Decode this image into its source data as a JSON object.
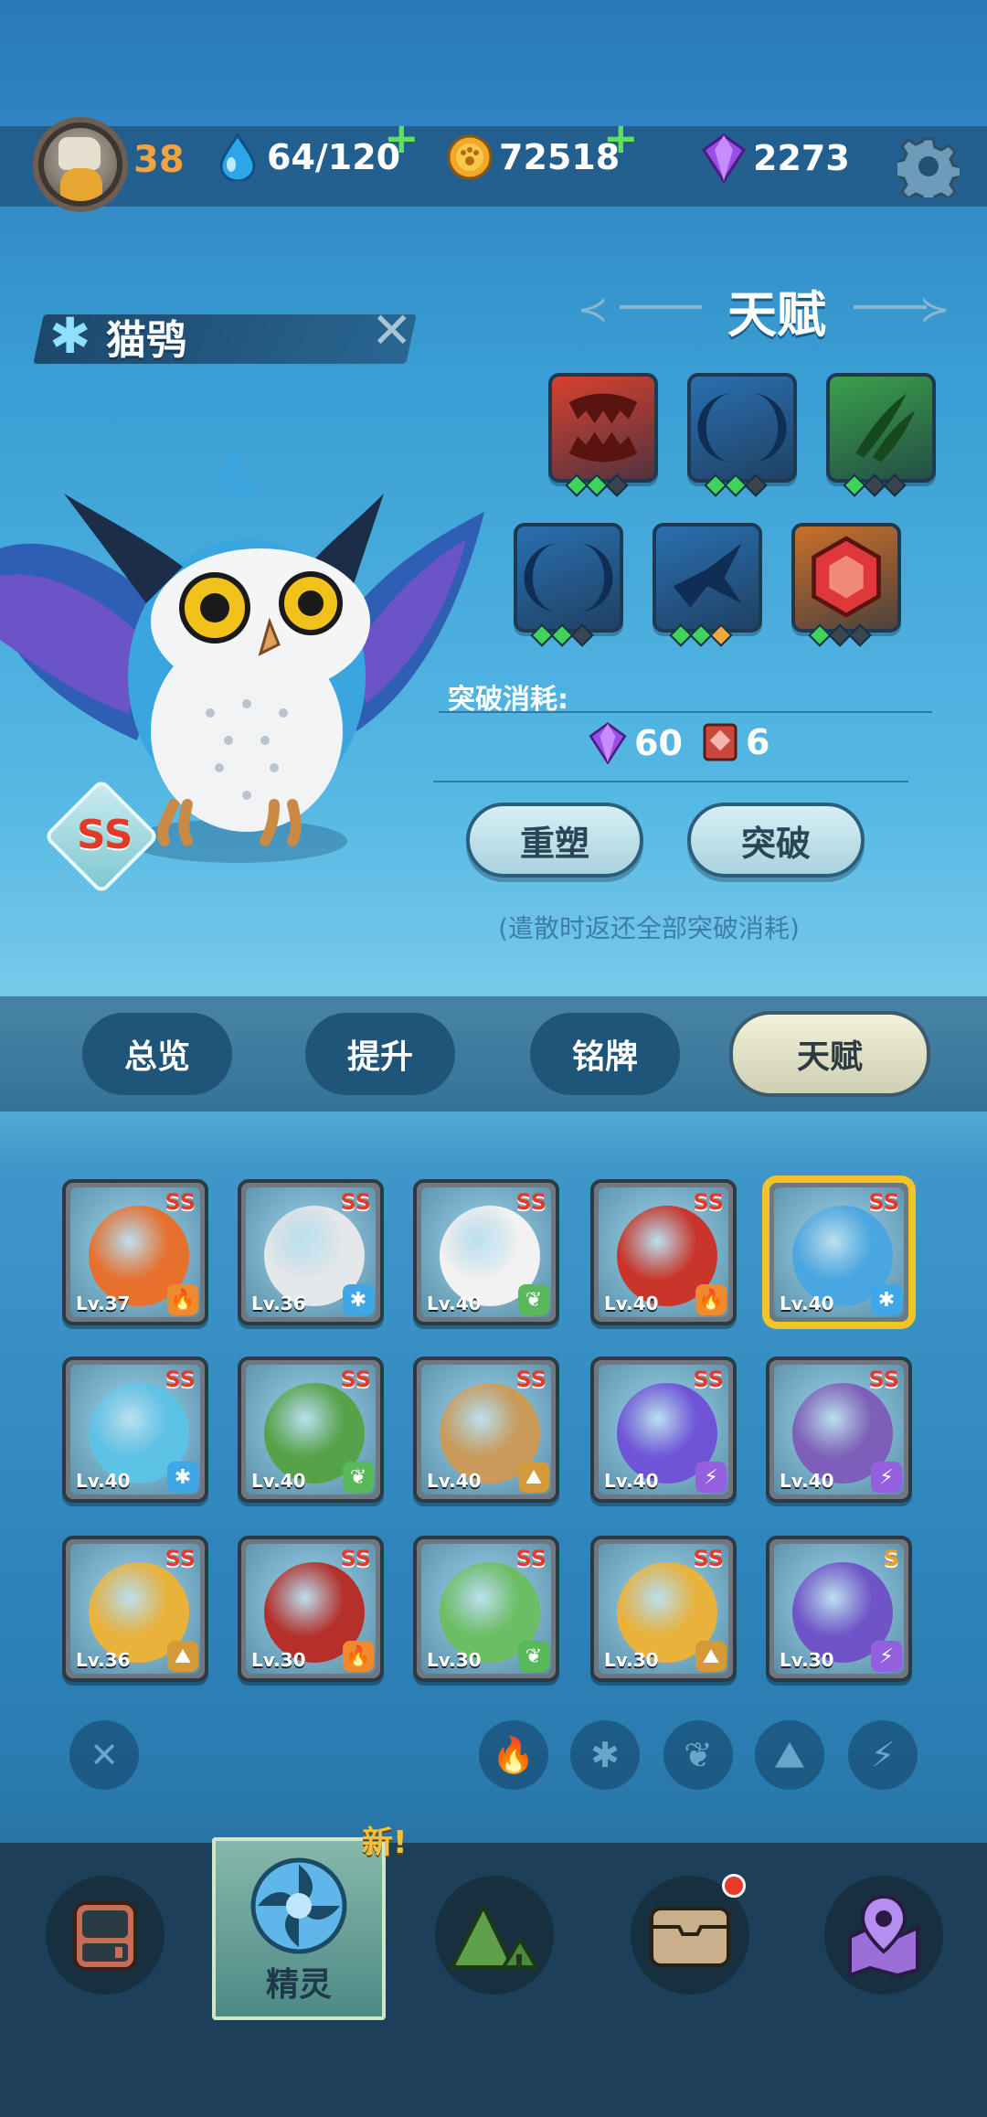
{
  "status_bar": {
    "player_level": "38",
    "stamina": "64/120",
    "coins": "72518",
    "gems": "2273",
    "plus_symbol": "+"
  },
  "creature": {
    "name": "猫鸮",
    "rank": "SS",
    "element_icon": "snowflake-icon"
  },
  "talent": {
    "title": "天赋",
    "slots": [
      {
        "icon": "fang-icon",
        "color": "#d8402f",
        "pips": [
          "g",
          "g",
          "d"
        ]
      },
      {
        "icon": "crescent-icon",
        "color": "#2a6fb0",
        "pips": [
          "g",
          "g",
          "d"
        ]
      },
      {
        "icon": "claw-icon",
        "color": "#3aa04a",
        "pips": [
          "g",
          "d",
          "d"
        ]
      },
      {
        "icon": "crescent-icon",
        "color": "#2a6fb0",
        "pips": [
          "g",
          "g",
          "d"
        ]
      },
      {
        "icon": "bird-icon",
        "color": "#2a6fb0",
        "pips": [
          "g",
          "g",
          "o"
        ]
      },
      {
        "icon": "hexagon-gem-icon",
        "color": "#c9702a",
        "pips": [
          "g",
          "d",
          "d"
        ]
      }
    ],
    "breakthrough_cost_label": "突破消耗:",
    "cost_gems": "60",
    "cost_books": "6",
    "reshape_label": "重塑",
    "breakthrough_label": "突破",
    "note": "(遣散时返还全部突破消耗)"
  },
  "tabs": [
    "总览",
    "提升",
    "铭牌",
    "天赋"
  ],
  "active_tab": "天赋",
  "roster": [
    {
      "level": "Lv.37",
      "rank": "SS",
      "element": "fire",
      "color": "#e8702d"
    },
    {
      "level": "Lv.36",
      "rank": "SS",
      "element": "ice",
      "color": "#e4e8ea"
    },
    {
      "level": "Lv.40",
      "rank": "SS",
      "element": "grass",
      "color": "#f2f2f2"
    },
    {
      "level": "Lv.40",
      "rank": "SS",
      "element": "fire",
      "color": "#c9352a"
    },
    {
      "level": "Lv.40",
      "rank": "SS",
      "element": "ice",
      "color": "#4aa6e0"
    },
    {
      "level": "Lv.40",
      "rank": "SS",
      "element": "ice",
      "color": "#5cc2e6"
    },
    {
      "level": "Lv.40",
      "rank": "SS",
      "element": "grass",
      "color": "#56a248"
    },
    {
      "level": "Lv.40",
      "rank": "SS",
      "element": "earth",
      "color": "#c99a58"
    },
    {
      "level": "Lv.40",
      "rank": "SS",
      "element": "electric",
      "color": "#6f54d8"
    },
    {
      "level": "Lv.40",
      "rank": "SS",
      "element": "electric",
      "color": "#7d5eb8"
    },
    {
      "level": "Lv.36",
      "rank": "SS",
      "element": "earth",
      "color": "#e9b23a"
    },
    {
      "level": "Lv.30",
      "rank": "SS",
      "element": "fire",
      "color": "#b5302a"
    },
    {
      "level": "Lv.30",
      "rank": "SS",
      "element": "grass",
      "color": "#6cbe62"
    },
    {
      "level": "Lv.30",
      "rank": "SS",
      "element": "earth",
      "color": "#e9b23a"
    },
    {
      "level": "Lv.30",
      "rank": "S",
      "element": "electric",
      "color": "#6f54c8"
    }
  ],
  "element_colors": {
    "fire": "#f08a2e",
    "ice": "#3fa7e8",
    "grass": "#58b85a",
    "earth": "#d49a3a",
    "electric": "#9560e0"
  },
  "element_glyphs": {
    "fire": "🔥",
    "ice": "✱",
    "grass": "❦",
    "earth": "⛰",
    "electric": "⚡"
  },
  "filters": [
    "clear",
    "fire",
    "ice",
    "grass",
    "earth",
    "electric"
  ],
  "nav": {
    "active_label": "精灵",
    "new_badge": "新!"
  }
}
